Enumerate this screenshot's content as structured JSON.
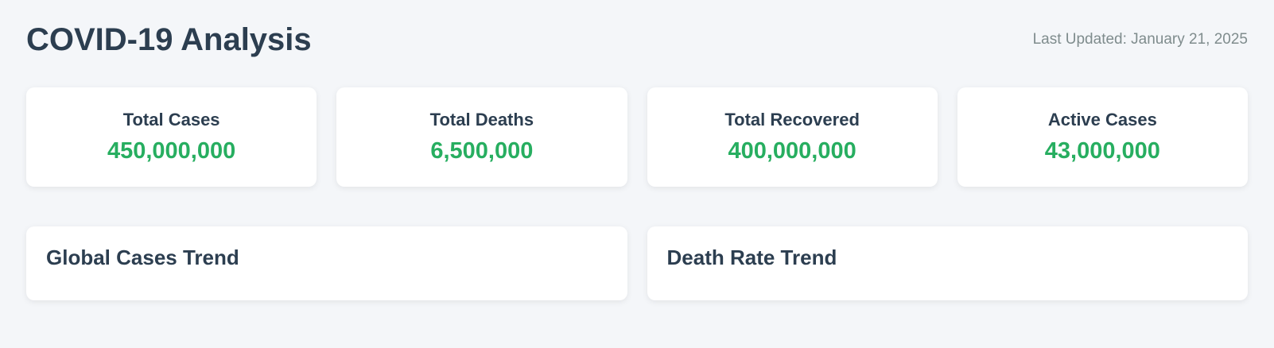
{
  "header": {
    "title": "COVID-19 Analysis",
    "last_updated": "Last Updated: January 21, 2025"
  },
  "stats": [
    {
      "label": "Total Cases",
      "value": "450,000,000"
    },
    {
      "label": "Total Deaths",
      "value": "6,500,000"
    },
    {
      "label": "Total Recovered",
      "value": "400,000,000"
    },
    {
      "label": "Active Cases",
      "value": "43,000,000"
    }
  ],
  "charts": [
    {
      "title": "Global Cases Trend"
    },
    {
      "title": "Death Rate Trend"
    }
  ],
  "colors": {
    "background": "#f4f6f9",
    "text": "#2c3e50",
    "accent_green": "#27ae60",
    "muted": "#7f8c8d"
  }
}
